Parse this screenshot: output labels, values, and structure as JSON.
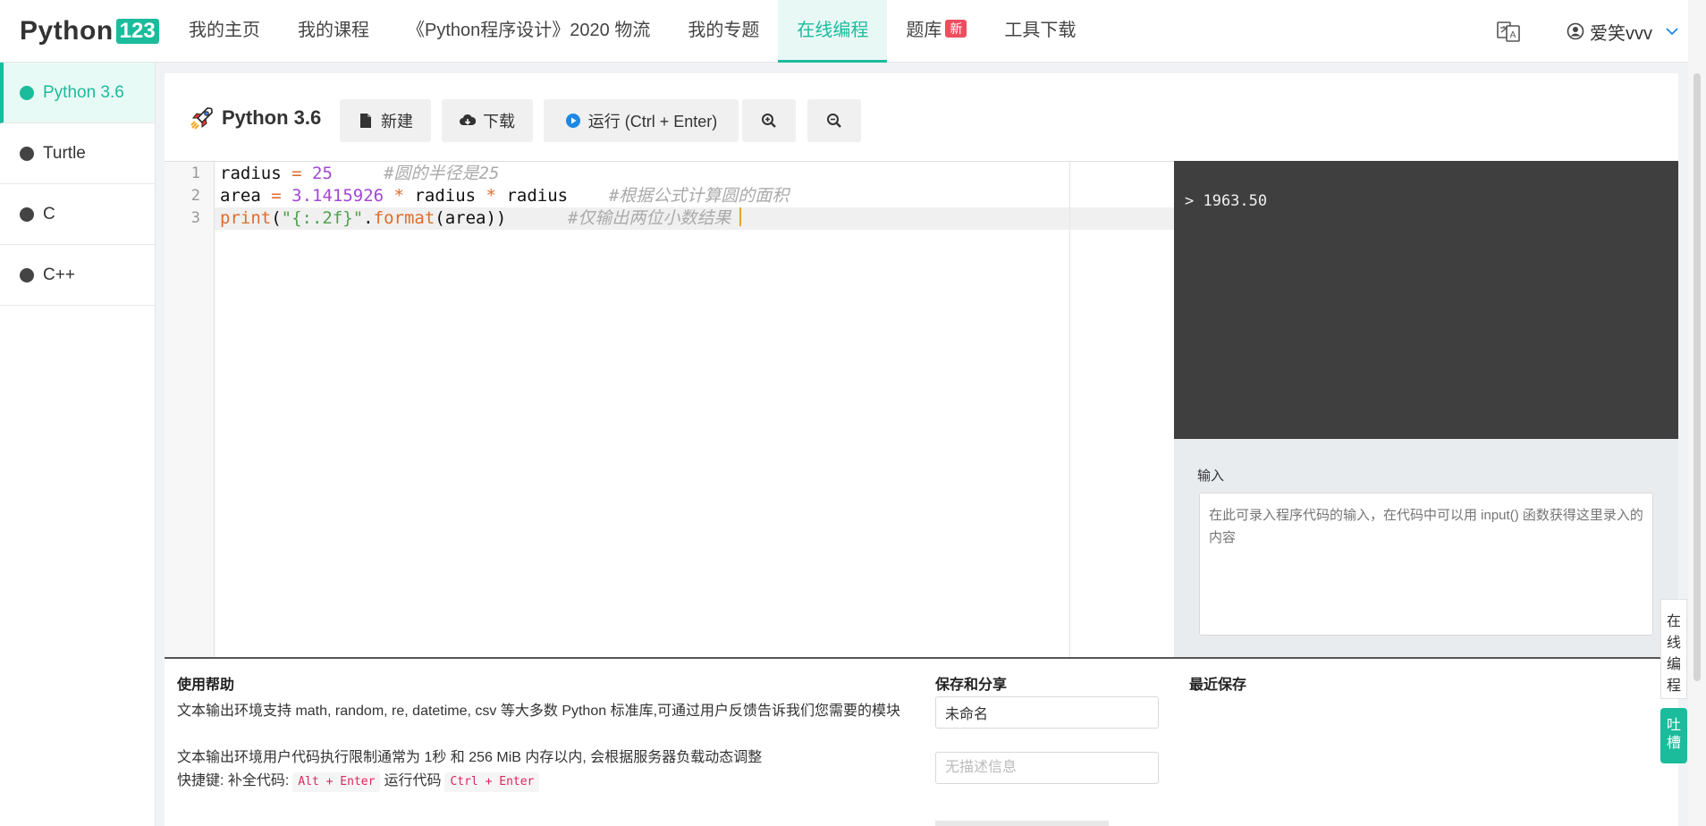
{
  "logo": {
    "text": "Python",
    "badge": "123"
  },
  "nav": {
    "items": [
      {
        "label": "我的主页"
      },
      {
        "label": "我的课程"
      },
      {
        "label": "《Python程序设计》2020 物流"
      },
      {
        "label": "我的专题"
      },
      {
        "label": "在线编程",
        "active": true
      },
      {
        "label": "题库",
        "badge": "新"
      },
      {
        "label": "工具下载"
      }
    ],
    "user": "爱笑vvv"
  },
  "sidebar": {
    "items": [
      {
        "label": "Python 3.6",
        "active": true
      },
      {
        "label": "Turtle"
      },
      {
        "label": "C"
      },
      {
        "label": "C++"
      }
    ]
  },
  "toolbar": {
    "title": "Python 3.6",
    "new_label": "新建",
    "download_label": "下载",
    "run_label": "运行 (Ctrl + Enter)"
  },
  "editor": {
    "line_numbers": [
      "1",
      "2",
      "3"
    ],
    "code": {
      "l1_var": "radius",
      "l1_op": "=",
      "l1_num": "25",
      "l1_comment": "#圆的半径是25",
      "l2_var": "area",
      "l2_op": "=",
      "l2_num": "3.1415926",
      "l2_op2": "*",
      "l2_var2": "radius",
      "l2_op3": "*",
      "l2_var3": "radius",
      "l2_comment": "#根据公式计算圆的面积",
      "l3_fn": "print",
      "l3_open": "(",
      "l3_str": "\"{:.2f}\"",
      "l3_dot": ".",
      "l3_method": "format",
      "l3_args": "(area))",
      "l3_comment": "#仅输出两位小数结果"
    }
  },
  "output": {
    "line": "> 1963.50"
  },
  "input": {
    "label": "输入",
    "placeholder": "在此可录入程序代码的输入，在代码中可以用 input() 函数获得这里录入的内容"
  },
  "help": {
    "title": "使用帮助",
    "line1": "文本输出环境支持 math, random, re, datetime, csv 等大多数 Python 标准库,可通过用户反馈告诉我们您需要的模块",
    "line2": "文本输出环境用户代码执行限制通常为 1秒 和 256 MiB 内存以内, 会根据服务器负载动态调整",
    "shortcut_prefix": "快捷键: 补全代码:",
    "shortcut_complete": "Alt + Enter",
    "shortcut_mid": "运行代码",
    "shortcut_run": "Ctrl + Enter"
  },
  "save": {
    "title": "保存和分享",
    "name_value": "未命名",
    "desc_placeholder": "无描述信息"
  },
  "recent": {
    "title": "最近保存"
  },
  "float": {
    "online_tab": "在线编程",
    "feedback_tab": "吐槽"
  },
  "colors": {
    "accent": "#1abc9c",
    "badge": "#ee4d5e",
    "output_bg": "#3f3f3f"
  }
}
